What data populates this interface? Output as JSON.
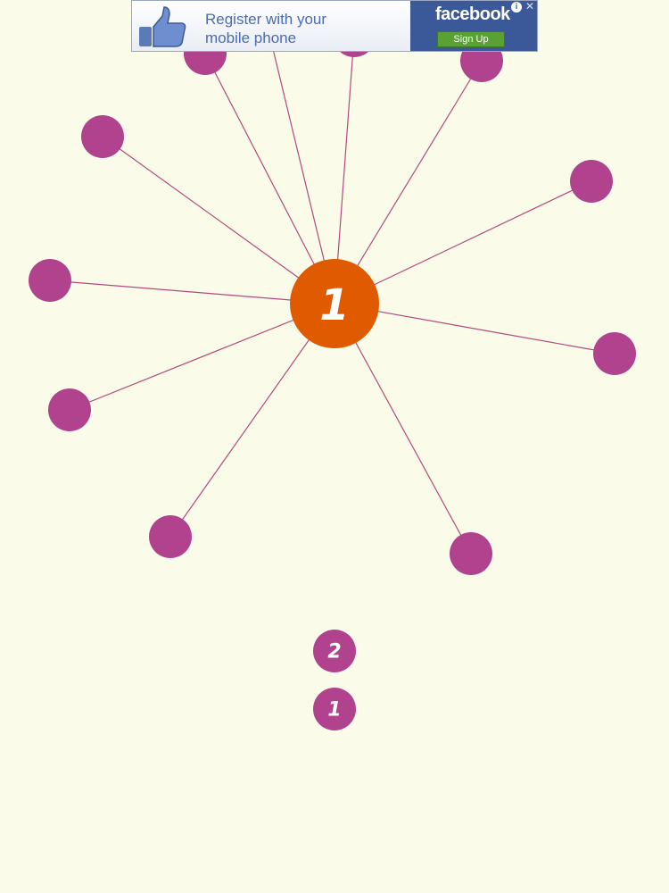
{
  "colors": {
    "background": "#fbfbe9",
    "pin": "#b0428e",
    "line": "#b34a7e",
    "hub": "#e05a00",
    "ad_blue": "#3b5998",
    "ad_button": "#5aa134"
  },
  "ad": {
    "text": "Register with your mobile phone",
    "brand": "facebook",
    "button_label": "Sign Up",
    "info_icon": "info-icon",
    "close_icon": "close-icon",
    "thumb_icon": "thumbs-up-icon"
  },
  "game": {
    "level": "1",
    "pins_on_wheel": 11,
    "queue": [
      "2",
      "1"
    ]
  }
}
